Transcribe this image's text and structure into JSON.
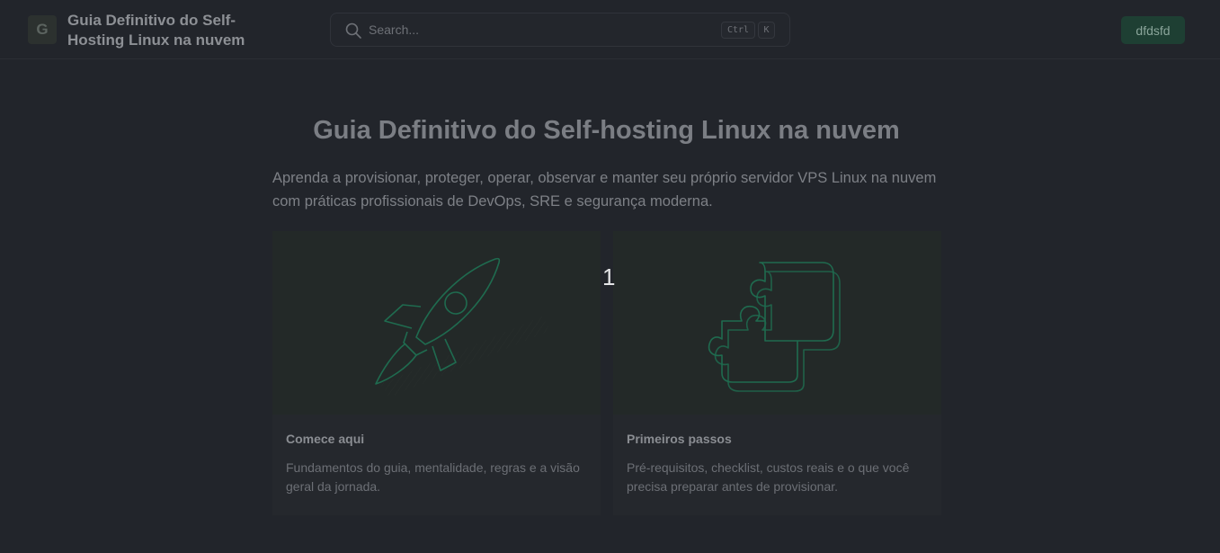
{
  "header": {
    "logo_letter": "G",
    "site_title": "Guia Definitivo do Self-Hosting Linux na nuvem",
    "search_placeholder": "Search...",
    "shortcut_ctrl": "Ctrl",
    "shortcut_k": "K",
    "user_button": "dfdsfd"
  },
  "main": {
    "title": "Guia Definitivo do Self-hosting Linux na nuvem",
    "intro": "Aprenda a provisionar, proteger, operar, observar e manter seu próprio servidor VPS Linux na nuvem com práticas profissionais de DevOps, SRE e segurança moderna.",
    "cards": [
      {
        "icon": "rocket-icon",
        "title": "Comece aqui",
        "description": "Fundamentos do guia, mentalidade, regras e a visão geral da jornada."
      },
      {
        "icon": "puzzle-icon",
        "title": "Primeiros passos",
        "description": "Pré-requisitos, checklist, custos reais e o que você precisa preparar antes de provisionar."
      }
    ]
  },
  "overlay_badge": "1",
  "colors": {
    "background": "#22252b",
    "accent": "#1e3f33",
    "illustration_stroke": "#1f6b4f"
  }
}
